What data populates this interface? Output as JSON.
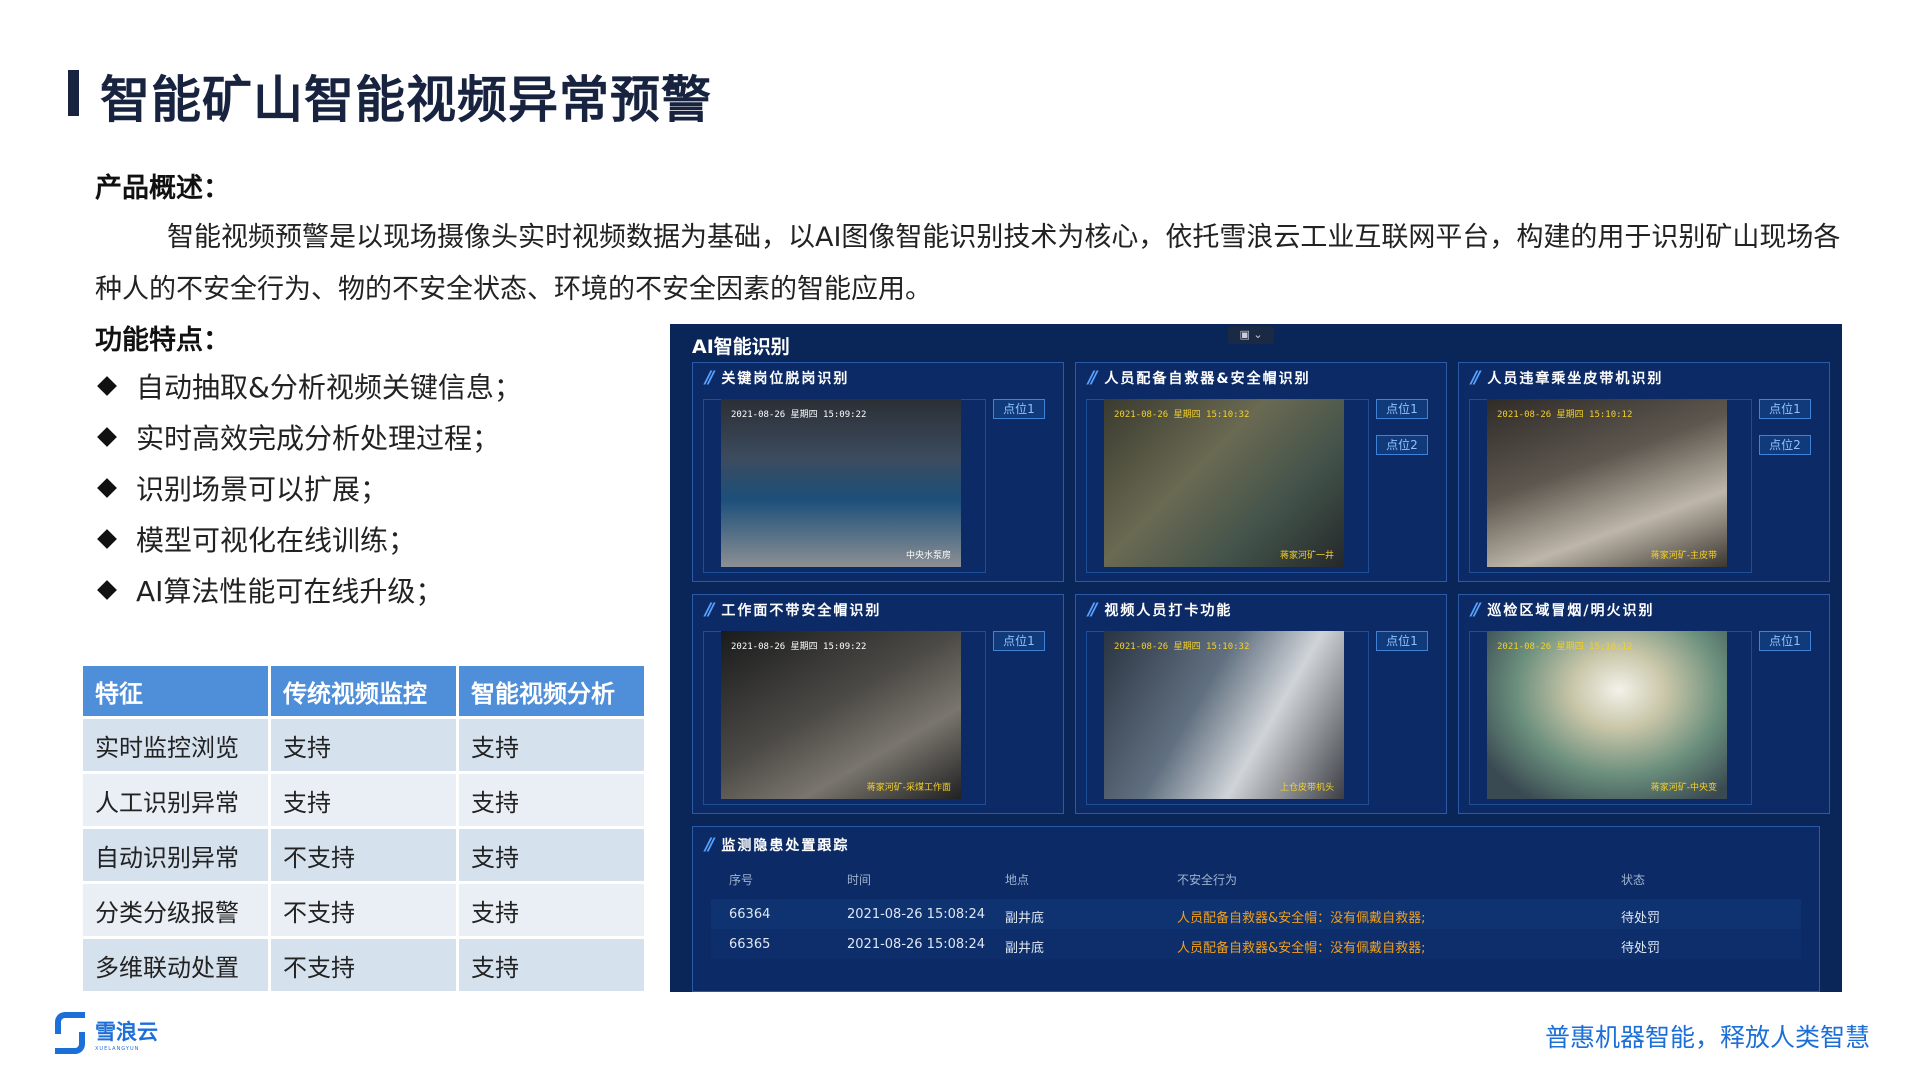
{
  "page": {
    "title": "智能矿山智能视频异常预警",
    "overview_heading": "产品概述：",
    "overview_text": "智能视频预警是以现场摄像头实时视频数据为基础，以AI图像智能识别技术为核心，依托雪浪云工业互联网平台，构建的用于识别矿山现场各种人的不安全行为、物的不安全状态、环境的不安全因素的智能应用。",
    "features_heading": "功能特点：",
    "features": [
      "自动抽取&分析视频关键信息；",
      "实时高效完成分析处理过程；",
      "识别场景可以扩展；",
      "模型可视化在线训练；",
      "AI算法性能可在线升级；"
    ]
  },
  "comparison_table": {
    "headers": [
      "特征",
      "传统视频监控",
      "智能视频分析"
    ],
    "rows": [
      [
        "实时监控浏览",
        "支持",
        "支持"
      ],
      [
        "人工识别异常",
        "支持",
        "支持"
      ],
      [
        "自动识别异常",
        "不支持",
        "支持"
      ],
      [
        "分类分级报警",
        "不支持",
        "支持"
      ],
      [
        "多维联动处置",
        " 不支持",
        "支持"
      ]
    ]
  },
  "dashboard": {
    "title": "AI智能识别",
    "panels": [
      {
        "title": "关键岗位脱岗识别",
        "timestamp": "2021-08-26 星期四 15:09:22",
        "location": "中央水泵房",
        "points": [
          "点位1"
        ]
      },
      {
        "title": "人员配备自救器&安全帽识别",
        "timestamp": "2021-08-26 星期四 15:10:32",
        "location": "蒋家河矿一井",
        "points": [
          "点位1",
          "点位2"
        ]
      },
      {
        "title": "人员违章乘坐皮带机识别",
        "timestamp": "2021-08-26 星期四 15:10:12",
        "location": "蒋家河矿-主皮带",
        "points": [
          "点位1",
          "点位2"
        ]
      },
      {
        "title": "工作面不带安全帽识别",
        "timestamp": "2021-08-26 星期四 15:09:22",
        "location": "蒋家河矿-采煤工作面",
        "points": [
          "点位1"
        ]
      },
      {
        "title": "视频人员打卡功能",
        "timestamp": "2021-08-26 星期四 15:10:32",
        "location": "上仓皮带机头",
        "points": [
          "点位1"
        ]
      },
      {
        "title": "巡检区域冒烟/明火识别",
        "timestamp": "2021-08-26 星期四 15:10:12",
        "location": "蒋家河矿-中央变",
        "points": [
          "点位1"
        ]
      }
    ],
    "tracking": {
      "title": "监测隐患处置跟踪",
      "headers": [
        "序号",
        "时间",
        "地点",
        "不安全行为",
        "状态"
      ],
      "rows": [
        [
          "66364",
          "2021-08-26 15:08:24",
          "副井底",
          "人员配备自救器&安全帽：没有佩戴自救器;",
          "待处罚"
        ],
        [
          "66365",
          "2021-08-26 15:08:24",
          "副井底",
          "人员配备自救器&安全帽：没有佩戴自救器;",
          "待处罚"
        ]
      ]
    }
  },
  "footer": {
    "logo_cn": "雪浪云",
    "logo_en": "XUELANGYUN",
    "slogan": "普惠机器智能，释放人类智慧"
  },
  "colors": {
    "title": "#17233f",
    "table_header": "#4f8ed9",
    "dashboard_bg": "#0a2558",
    "accent_blue": "#1d6fd8",
    "alert_orange": "#f1a11e"
  }
}
